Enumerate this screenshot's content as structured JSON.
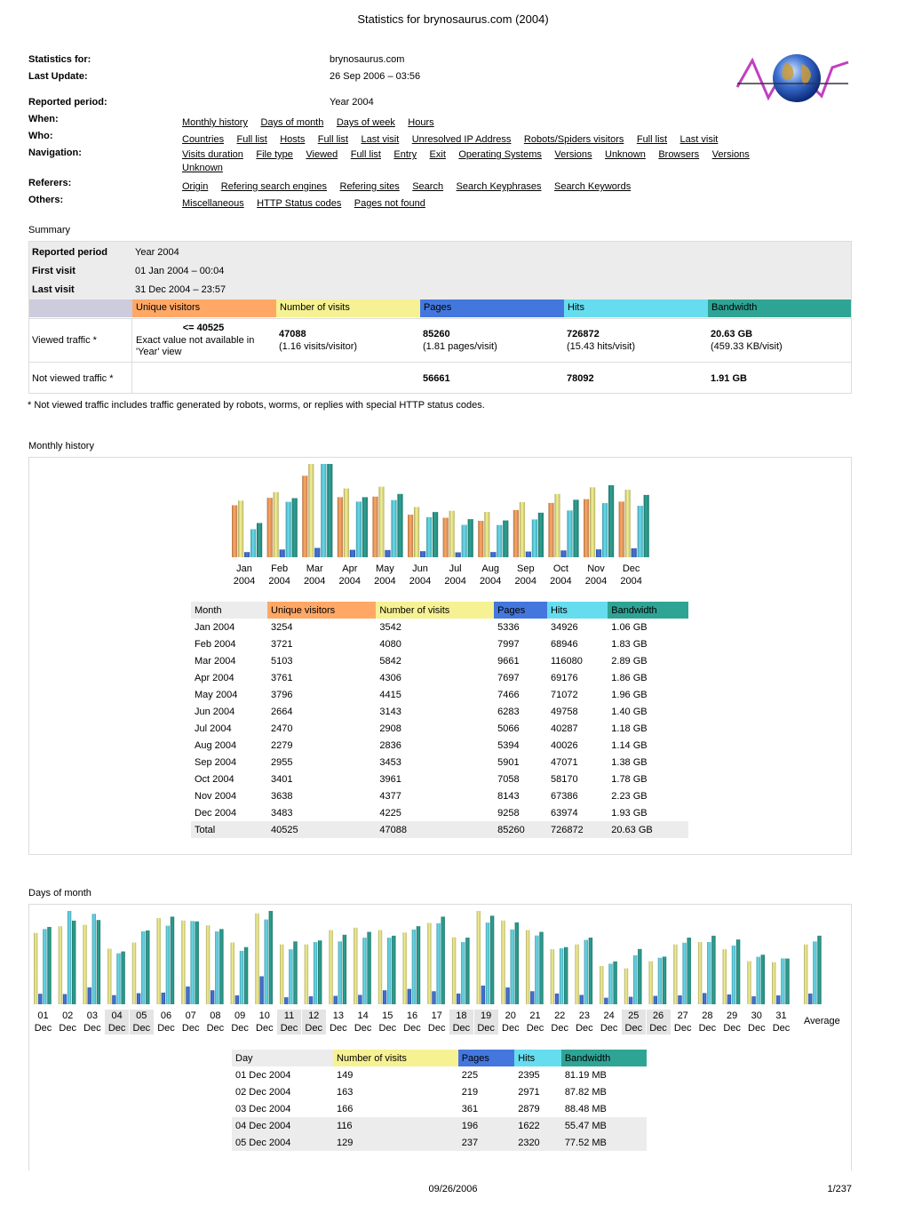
{
  "page_title": "Statistics for brynosaurus.com (2004)",
  "header": {
    "stats_for_label": "Statistics for:",
    "stats_for_value": "brynosaurus.com",
    "last_update_label": "Last Update:",
    "last_update_value": "26 Sep 2006 – 03:56",
    "reported_period_label": "Reported period:",
    "reported_period_value": "Year 2004"
  },
  "nav": {
    "when_label": "When:",
    "when_links": [
      "Monthly history",
      "Days of month",
      "Days of week",
      "Hours"
    ],
    "who_label": "Who:",
    "who_links": [
      "Countries",
      "Full list",
      "Hosts",
      "Full list",
      "Last visit",
      "Unresolved IP Address",
      "Robots/Spiders visitors",
      "Full list",
      "Last visit"
    ],
    "navigation_label": "Navigation:",
    "navigation_links": [
      "Visits duration",
      "File type",
      "Viewed",
      "Full list",
      "Entry",
      "Exit",
      "Operating Systems",
      "Versions",
      "Unknown",
      "Browsers",
      "Versions",
      "Unknown"
    ],
    "referers_label": "Referers:",
    "referers_links": [
      "Origin",
      "Refering search engines",
      "Refering sites",
      "Search",
      "Search Keyphrases",
      "Search Keywords"
    ],
    "others_label": "Others:",
    "others_links": [
      "Miscellaneous",
      "HTTP Status codes",
      "Pages not found"
    ]
  },
  "summary": {
    "section_title": "Summary",
    "reported_period_label": "Reported period",
    "reported_period_value": "Year 2004",
    "first_visit_label": "First visit",
    "first_visit_value": "01 Jan 2004 – 00:04",
    "last_visit_label": "Last visit",
    "last_visit_value": "31 Dec 2004 – 23:57",
    "col_unique": "Unique visitors",
    "col_visits": "Number of visits",
    "col_pages": "Pages",
    "col_hits": "Hits",
    "col_bandwidth": "Bandwidth",
    "viewed_label": "Viewed traffic *",
    "viewed_unique": "<= 40525",
    "viewed_unique_note": "Exact value not available in 'Year' view",
    "viewed_visits": "47088",
    "viewed_visits_note": "(1.16 visits/visitor)",
    "viewed_pages": "85260",
    "viewed_pages_note": "(1.81 pages/visit)",
    "viewed_hits": "726872",
    "viewed_hits_note": "(15.43 hits/visit)",
    "viewed_bw": "20.63 GB",
    "viewed_bw_note": "(459.33 KB/visit)",
    "not_viewed_label": "Not viewed traffic *",
    "not_viewed_pages": "56661",
    "not_viewed_hits": "78092",
    "not_viewed_bw": "1.91 GB",
    "footnote": "* Not viewed traffic includes traffic generated by robots, worms, or replies with special HTTP status codes."
  },
  "monthly": {
    "section_title": "Monthly history",
    "headers": [
      "Month",
      "Unique visitors",
      "Number of visits",
      "Pages",
      "Hits",
      "Bandwidth"
    ],
    "rows": [
      [
        "Jan 2004",
        "3254",
        "3542",
        "5336",
        "34926",
        "1.06 GB"
      ],
      [
        "Feb 2004",
        "3721",
        "4080",
        "7997",
        "68946",
        "1.83 GB"
      ],
      [
        "Mar 2004",
        "5103",
        "5842",
        "9661",
        "116080",
        "2.89 GB"
      ],
      [
        "Apr 2004",
        "3761",
        "4306",
        "7697",
        "69176",
        "1.86 GB"
      ],
      [
        "May 2004",
        "3796",
        "4415",
        "7466",
        "71072",
        "1.96 GB"
      ],
      [
        "Jun 2004",
        "2664",
        "3143",
        "6283",
        "49758",
        "1.40 GB"
      ],
      [
        "Jul 2004",
        "2470",
        "2908",
        "5066",
        "40287",
        "1.18 GB"
      ],
      [
        "Aug 2004",
        "2279",
        "2836",
        "5394",
        "40026",
        "1.14 GB"
      ],
      [
        "Sep 2004",
        "2955",
        "3453",
        "5901",
        "47071",
        "1.38 GB"
      ],
      [
        "Oct 2004",
        "3401",
        "3961",
        "7058",
        "58170",
        "1.78 GB"
      ],
      [
        "Nov 2004",
        "3638",
        "4377",
        "8143",
        "67386",
        "2.23 GB"
      ],
      [
        "Dec 2004",
        "3483",
        "4225",
        "9258",
        "63974",
        "1.93 GB"
      ]
    ],
    "total": [
      "Total",
      "40525",
      "47088",
      "85260",
      "726872",
      "20.63 GB"
    ],
    "chart_months": [
      "Jan",
      "Feb",
      "Mar",
      "Apr",
      "May",
      "Jun",
      "Jul",
      "Aug",
      "Sep",
      "Oct",
      "Nov",
      "Dec"
    ],
    "chart_year": "2004"
  },
  "days": {
    "section_title": "Days of month",
    "day_nums": [
      "01",
      "02",
      "03",
      "04",
      "05",
      "06",
      "07",
      "08",
      "09",
      "10",
      "11",
      "12",
      "13",
      "14",
      "15",
      "16",
      "17",
      "18",
      "19",
      "20",
      "21",
      "22",
      "23",
      "24",
      "25",
      "26",
      "27",
      "28",
      "29",
      "30",
      "31"
    ],
    "day_month": "Dec",
    "average_label": "Average",
    "weekend_days": [
      "04",
      "05",
      "11",
      "12",
      "18",
      "19",
      "25",
      "26"
    ],
    "headers": [
      "Day",
      "Number of visits",
      "Pages",
      "Hits",
      "Bandwidth"
    ],
    "rows": [
      [
        "01 Dec 2004",
        "149",
        "225",
        "2395",
        "81.19 MB"
      ],
      [
        "02 Dec 2004",
        "163",
        "219",
        "2971",
        "87.82 MB"
      ],
      [
        "03 Dec 2004",
        "166",
        "361",
        "2879",
        "88.48 MB"
      ],
      [
        "04 Dec 2004",
        "116",
        "196",
        "1622",
        "55.47 MB"
      ],
      [
        "05 Dec 2004",
        "129",
        "237",
        "2320",
        "77.52 MB"
      ]
    ]
  },
  "chart_data": [
    {
      "type": "bar",
      "title": "Monthly history",
      "categories": [
        "Jan 2004",
        "Feb 2004",
        "Mar 2004",
        "Apr 2004",
        "May 2004",
        "Jun 2004",
        "Jul 2004",
        "Aug 2004",
        "Sep 2004",
        "Oct 2004",
        "Nov 2004",
        "Dec 2004"
      ],
      "series": [
        {
          "name": "Unique visitors",
          "values": [
            3254,
            3721,
            5103,
            3761,
            3796,
            2664,
            2470,
            2279,
            2955,
            3401,
            3638,
            3483
          ]
        },
        {
          "name": "Number of visits",
          "values": [
            3542,
            4080,
            5842,
            4306,
            4415,
            3143,
            2908,
            2836,
            3453,
            3961,
            4377,
            4225
          ]
        },
        {
          "name": "Pages",
          "values": [
            5336,
            7997,
            9661,
            7697,
            7466,
            6283,
            5066,
            5394,
            5901,
            7058,
            8143,
            9258
          ]
        },
        {
          "name": "Hits",
          "values": [
            34926,
            68946,
            116080,
            69176,
            71072,
            49758,
            40287,
            40026,
            47071,
            58170,
            67386,
            63974
          ]
        },
        {
          "name": "Bandwidth",
          "values": [
            1.06,
            1.83,
            2.89,
            1.86,
            1.96,
            1.4,
            1.18,
            1.14,
            1.38,
            1.78,
            2.23,
            1.93
          ]
        }
      ]
    },
    {
      "type": "bar",
      "title": "Days of month",
      "categories": [
        "01 Dec",
        "02 Dec",
        "03 Dec",
        "04 Dec",
        "05 Dec",
        "06 Dec",
        "07 Dec",
        "08 Dec",
        "09 Dec",
        "10 Dec",
        "11 Dec",
        "12 Dec",
        "13 Dec",
        "14 Dec",
        "15 Dec",
        "16 Dec",
        "17 Dec",
        "18 Dec",
        "19 Dec",
        "20 Dec",
        "21 Dec",
        "22 Dec",
        "23 Dec",
        "24 Dec",
        "25 Dec",
        "26 Dec",
        "27 Dec",
        "28 Dec",
        "29 Dec",
        "30 Dec",
        "31 Dec",
        "Average"
      ],
      "series": [
        {
          "name": "Number of visits",
          "values": [
            149,
            163,
            166,
            116,
            129,
            180,
            175,
            165,
            129,
            190,
            125,
            125,
            155,
            160,
            155,
            150,
            170,
            140,
            195,
            175,
            155,
            115,
            125,
            80,
            75,
            90,
            125,
            130,
            115,
            90,
            88,
            125
          ]
        },
        {
          "name": "Pages",
          "values": [
            225,
            219,
            361,
            196,
            237,
            250,
            380,
            300,
            190,
            600,
            150,
            170,
            180,
            200,
            300,
            330,
            280,
            230,
            400,
            360,
            280,
            230,
            200,
            140,
            160,
            180,
            190,
            240,
            210,
            170,
            190,
            230
          ]
        },
        {
          "name": "Hits",
          "values": [
            2395,
            2971,
            2879,
            1622,
            2320,
            2500,
            2650,
            2320,
            1700,
            2700,
            1750,
            1980,
            2000,
            2120,
            2120,
            2380,
            2580,
            1980,
            2600,
            2380,
            2190,
            1780,
            2050,
            1290,
            1560,
            1480,
            1960,
            1980,
            1870,
            1510,
            1460,
            2000
          ]
        },
        {
          "name": "Bandwidth",
          "values": [
            81.19,
            87.82,
            88.48,
            55.47,
            77.52,
            92,
            87,
            79,
            60,
            98,
            66,
            67,
            73,
            76,
            72,
            82,
            92,
            70,
            93,
            86,
            76,
            60,
            70,
            45,
            58,
            50,
            70,
            72,
            68,
            52,
            48,
            72
          ]
        }
      ]
    }
  ],
  "footer": {
    "date": "09/26/2006",
    "page": "1/237"
  },
  "colors": {
    "unique": "#ffa866",
    "visits": "#f6f293",
    "pages": "#4477dd",
    "hits": "#66ddee",
    "bandwidth": "#2ea495"
  }
}
